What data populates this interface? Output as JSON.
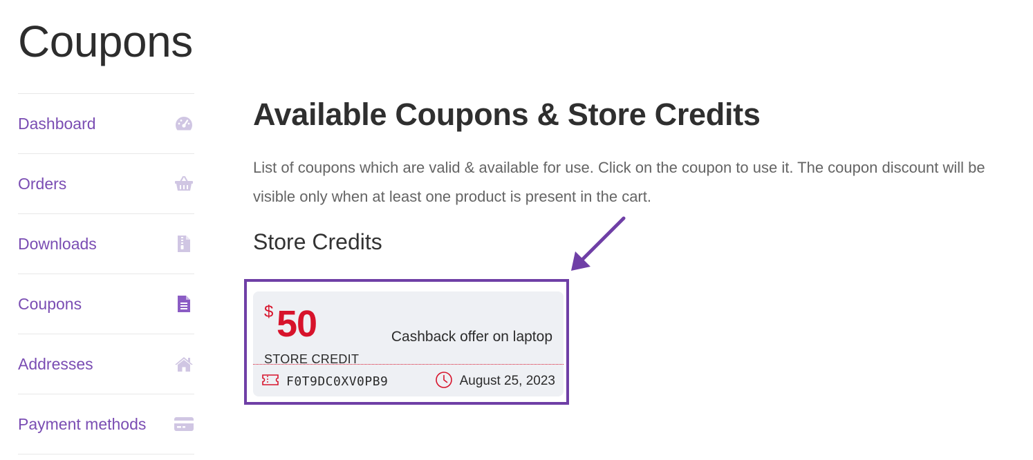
{
  "page": {
    "title": "Coupons"
  },
  "sidebar": {
    "items": [
      {
        "label": "Dashboard",
        "icon": "dashboard-gauge-icon"
      },
      {
        "label": "Orders",
        "icon": "basket-icon"
      },
      {
        "label": "Downloads",
        "icon": "file-archive-icon"
      },
      {
        "label": "Coupons",
        "icon": "document-icon",
        "active": true
      },
      {
        "label": "Addresses",
        "icon": "home-icon"
      },
      {
        "label": "Payment methods",
        "icon": "credit-card-icon"
      }
    ]
  },
  "main": {
    "heading": "Available Coupons & Store Credits",
    "intro": "List of coupons which are valid & available for use. Click on the coupon to use it. The coupon discount will be visible only when at least one product is present in the cart.",
    "section_title": "Store Credits"
  },
  "coupon": {
    "currency": "$",
    "amount": "50",
    "type": "STORE CREDIT",
    "description": "Cashback offer on laptop",
    "code": "F0T9DC0XV0PB9",
    "expiry": "August 25, 2023",
    "code_icon": "ticket-icon",
    "expiry_icon": "clock-icon"
  },
  "colors": {
    "accent": "#7a4db3",
    "highlight_border": "#6f3fa6",
    "coupon_red": "#d7132b",
    "coupon_bg": "#eef0f4",
    "icon_muted": "#d0c6e3"
  }
}
